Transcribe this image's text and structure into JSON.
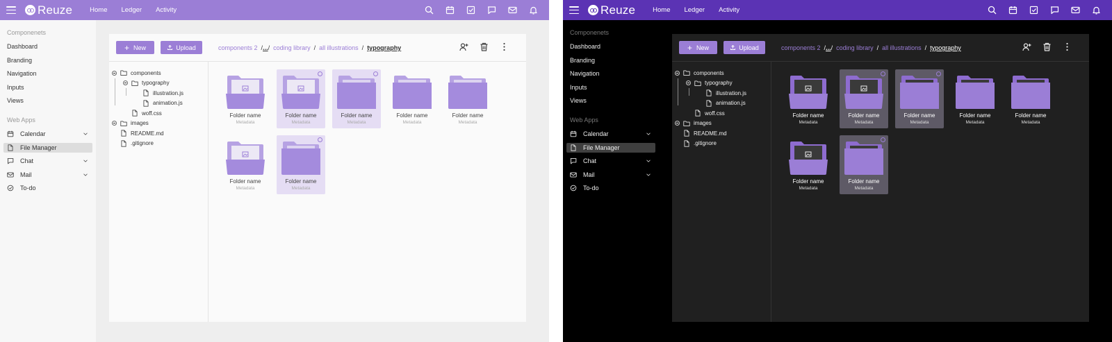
{
  "app": {
    "name": "Reuze"
  },
  "nav": [
    "Home",
    "Ledger",
    "Activity"
  ],
  "top_icons": [
    "search-icon",
    "calendar-icon",
    "checkbox-icon",
    "chat-icon",
    "mail-icon",
    "bell-icon"
  ],
  "sidebar": {
    "components_heading": "Componenets",
    "components": [
      "Dashboard",
      "Branding",
      "Navigation",
      "Inputs",
      "Views"
    ],
    "webapps_heading": "Web Apps",
    "webapps": [
      {
        "label": "Calendar",
        "icon": "calendar-icon",
        "expandable": true
      },
      {
        "label": "File Manager",
        "icon": "file-icon",
        "active": true
      },
      {
        "label": "Chat",
        "icon": "chat-icon",
        "expandable": true
      },
      {
        "label": "Mail",
        "icon": "mail-icon",
        "expandable": true
      },
      {
        "label": "To-do",
        "icon": "check-circle-icon"
      }
    ]
  },
  "toolbar": {
    "new_label": "New",
    "upload_label": "Upload"
  },
  "breadcrumb": {
    "items": [
      "components 2",
      "...",
      "coding library",
      "all illustrations"
    ],
    "current": "typography"
  },
  "panel_icons": [
    "add-user-icon",
    "trash-icon",
    "more-vertical-icon"
  ],
  "tree": [
    {
      "label": "components",
      "type": "folder",
      "toggle": "expanded"
    },
    {
      "label": "typography",
      "type": "folder",
      "toggle": "expanded"
    },
    {
      "label": "illustration.js",
      "type": "file"
    },
    {
      "label": "animation.js",
      "type": "file"
    },
    {
      "label": "woff.css",
      "type": "file"
    },
    {
      "label": "images",
      "type": "folder",
      "toggle": "collapsed"
    },
    {
      "label": "README.md",
      "type": "file"
    },
    {
      "label": ".gitignore",
      "type": "file"
    }
  ],
  "folders": [
    {
      "name": "Folder name",
      "meta": "Metadata",
      "preview": "image",
      "selected": false
    },
    {
      "name": "Folder name",
      "meta": "Metadata",
      "preview": "image",
      "selected": true
    },
    {
      "name": "Folder name",
      "meta": "Metadata",
      "preview": "blank",
      "selected": true
    },
    {
      "name": "Folder name",
      "meta": "Metadata",
      "preview": "blank",
      "selected": false
    },
    {
      "name": "Folder name",
      "meta": "Metadata",
      "preview": "blank",
      "selected": false
    },
    {
      "name": "Folder name",
      "meta": "Metadata",
      "preview": "image",
      "selected": false
    },
    {
      "name": "Folder name",
      "meta": "Metadata",
      "preview": "blank",
      "selected": true
    }
  ],
  "themes": {
    "light": {
      "accent": "#9b7ed6",
      "topbar": "#9b7ed6"
    },
    "dark": {
      "accent": "#9b7ed6",
      "topbar": "#5b33b4"
    }
  }
}
